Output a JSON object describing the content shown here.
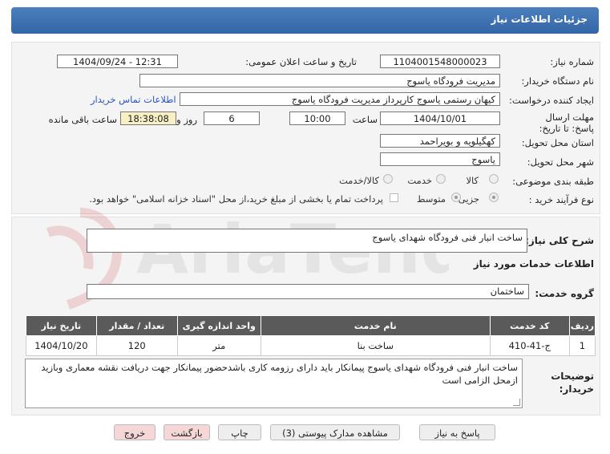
{
  "header": {
    "title": "جزئیات اطلاعات نیاز"
  },
  "fields": {
    "need_number_label": "شماره نیاز:",
    "need_number": "1104001548000023",
    "announce_label": "تاریخ و ساعت اعلان عمومی:",
    "announce_value": "1404/09/24 - 12:31",
    "buyer_org_label": "نام دستگاه خریدار:",
    "buyer_org": "مدیریت فرودگاه یاسوج",
    "requester_label": "ایجاد کننده درخواست:",
    "requester": "کیهان رستمی یاسوج کارپرداز مدیریت فرودگاه یاسوج",
    "contact_link": "اطلاعات تماس خریدار",
    "deadline_label": "مهلت ارسال پاسخ: تا تاریخ:",
    "deadline_date": "1404/10/01",
    "time_label": "ساعت",
    "deadline_time": "10:00",
    "days_value": "6",
    "days_label": "روز و",
    "remaining_time": "18:38:08",
    "remaining_label": "ساعت باقی مانده",
    "province_label": "استان محل تحویل:",
    "province": "کهگیلویه و بویراحمد",
    "city_label": "شهر محل تحویل:",
    "city": "یاسوج",
    "category_label": "طبقه بندی موضوعی:",
    "category_options": [
      "کالا",
      "خدمت",
      "کالا/خدمت"
    ],
    "category_selected": "خدمت",
    "process_label": "نوع فرآیند خرید :",
    "process_options": [
      "جزیی",
      "متوسط"
    ],
    "process_selected": "جزیی",
    "treasury_note": "پرداخت تمام یا بخشی از مبلغ خرید،از محل \"اسناد خزانه اسلامی\" خواهد بود."
  },
  "general": {
    "description_label": "شرح کلی نیاز:",
    "description": "ساخت انبار فنی فرودگاه شهدای یاسوج",
    "services_heading": "اطلاعات خدمات مورد نیاز",
    "service_group_label": "گروه خدمت:",
    "service_group": "ساختمان"
  },
  "table": {
    "headers": [
      "ردیف",
      "کد خدمت",
      "نام خدمت",
      "واحد اندازه گیری",
      "تعداد / مقدار",
      "تاریخ نیاز"
    ],
    "rows": [
      [
        "1",
        "ج-41-410",
        "ساخت بنا",
        "متر",
        "120",
        "1404/10/20"
      ]
    ]
  },
  "buyer_notes": {
    "label": "توضیحات خریدار:",
    "text": "ساخت انبار فنی فرودگاه شهدای یاسوج  پیمانکار باید دارای رزومه کاری باشدحضور پیمانکار جهت دریافت نقشه معماری وبازید ازمحل الزامی است"
  },
  "buttons": {
    "reply": "پاسخ به نیاز",
    "attachments": "مشاهده مدارک پیوستی (3)",
    "print": "چاپ",
    "back": "بازگشت",
    "exit": "خروج"
  },
  "watermark": {
    "text": "AriaTender.neT"
  },
  "colors": {
    "title_bar": "#3d6fb0",
    "link": "#2a55c0",
    "table_header": "#5a5a5a",
    "pink_button": "#f6d7d7",
    "remaining_box": "#f6f0c4"
  }
}
